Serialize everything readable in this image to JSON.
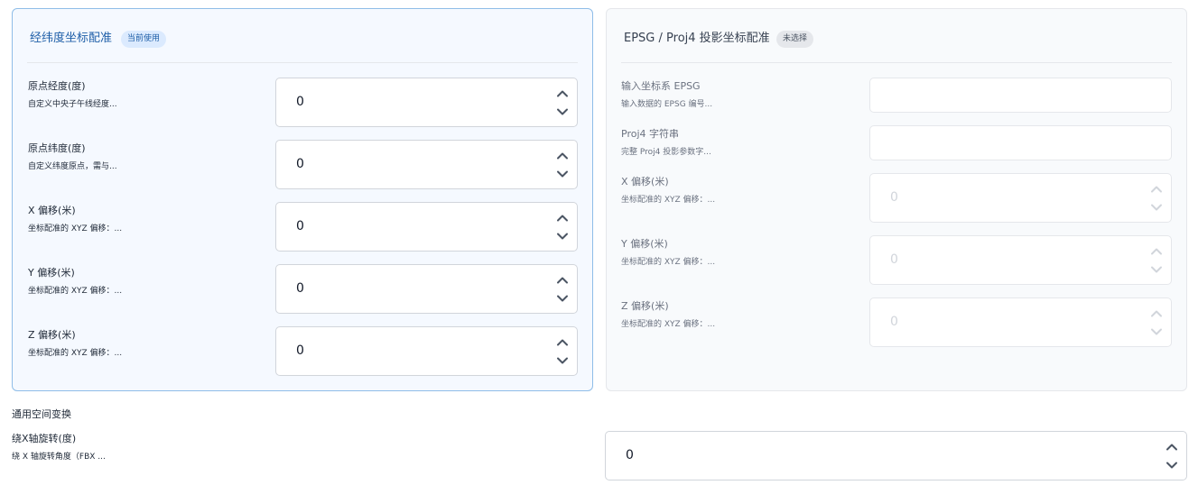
{
  "left_panel": {
    "title": "经纬度坐标配准",
    "badge": "当前使用",
    "fields": [
      {
        "label": "原点经度(度)",
        "desc": "自定义中央子午线经度...",
        "value": "0"
      },
      {
        "label": "原点纬度(度)",
        "desc": "自定义纬度原点，需与...",
        "value": "0"
      },
      {
        "label": "X 偏移(米)",
        "desc": "坐标配准的 XYZ 偏移：...",
        "value": "0"
      },
      {
        "label": "Y 偏移(米)",
        "desc": "坐标配准的 XYZ 偏移：...",
        "value": "0"
      },
      {
        "label": "Z 偏移(米)",
        "desc": "坐标配准的 XYZ 偏移：...",
        "value": "0"
      }
    ]
  },
  "right_panel": {
    "title": "EPSG / Proj4 投影坐标配准",
    "badge": "未选择",
    "epsg": {
      "label": "输入坐标系 EPSG",
      "desc": "输入数据的 EPSG 编号...",
      "value": ""
    },
    "proj4": {
      "label": "Proj4 字符串",
      "desc": "完整 Proj4 投影参数字...",
      "value": ""
    },
    "fields": [
      {
        "label": "X 偏移(米)",
        "desc": "坐标配准的 XYZ 偏移：...",
        "value": "0"
      },
      {
        "label": "Y 偏移(米)",
        "desc": "坐标配准的 XYZ 偏移：...",
        "value": "0"
      },
      {
        "label": "Z 偏移(米)",
        "desc": "坐标配准的 XYZ 偏移：...",
        "value": "0"
      }
    ]
  },
  "transform": {
    "section_title": "通用空间变换",
    "rotate_x": {
      "label": "绕X轴旋转(度)",
      "desc": "绕 X 轴旋转角度（FBX ...",
      "value": "0"
    }
  },
  "colors": {
    "accent": "#1f5fa8",
    "active_border": "#8fbde8",
    "active_bg": "#f5f9ff",
    "inactive_bg": "#f8fafc"
  },
  "icons": {
    "spin_up": "chevron-up-icon",
    "spin_down": "chevron-down-icon"
  }
}
